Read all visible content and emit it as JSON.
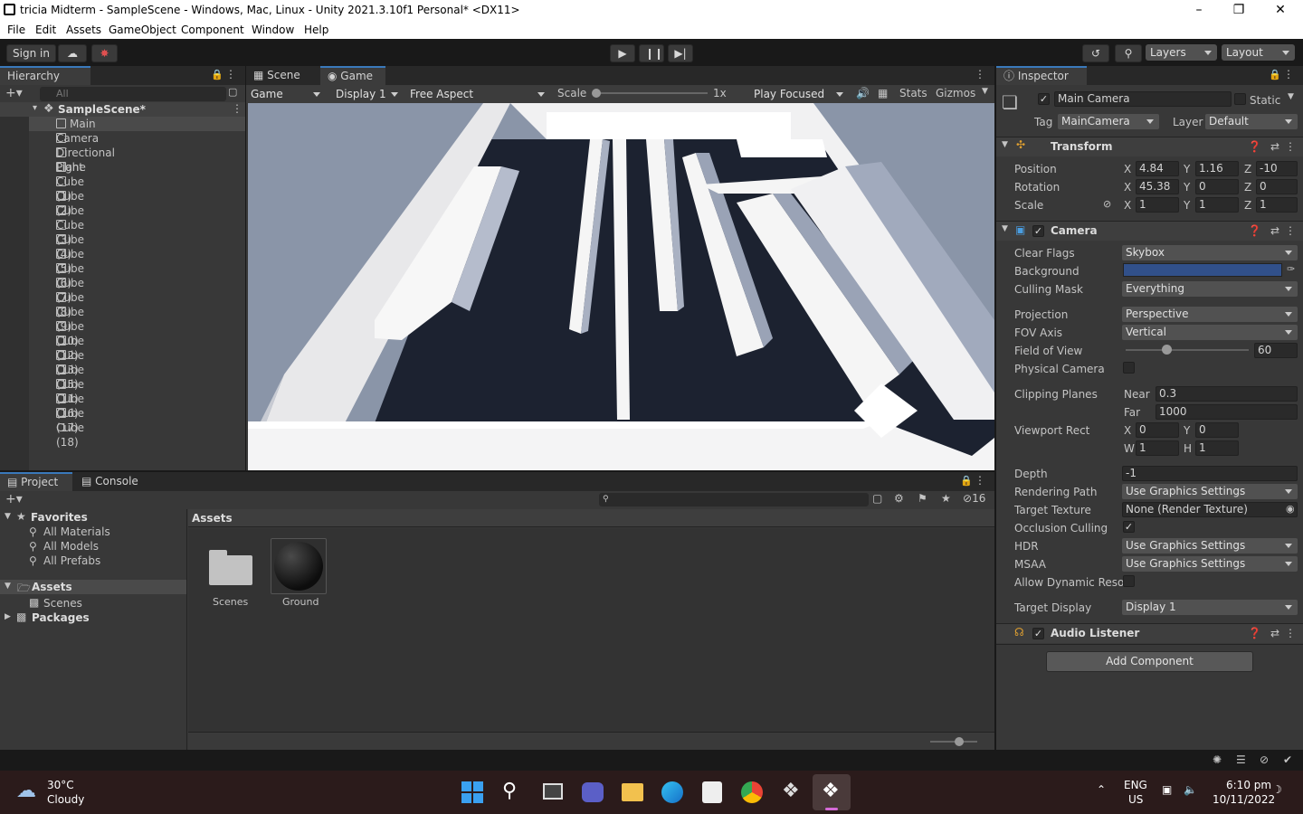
{
  "window": {
    "title": "tricia Midterm - SampleScene - Windows, Mac, Linux - Unity 2021.3.10f1 Personal* <DX11>"
  },
  "menu": [
    "File",
    "Edit",
    "Assets",
    "GameObject",
    "Component",
    "Window",
    "Help"
  ],
  "toolbar": {
    "sign_in": "Sign in",
    "layers": "Layers",
    "layout": "Layout"
  },
  "hierarchy": {
    "tab": "Hierarchy",
    "search_placeholder": "All",
    "scene": "SampleScene*",
    "items": [
      "Main Camera",
      "Directional Light",
      "Plane",
      "Cube (1)",
      "Cube (2)",
      "Cube",
      "Cube (3)",
      "Cube (4)",
      "Cube (5)",
      "Cube (6)",
      "Cube (7)",
      "Cube (8)",
      "Cube (9)",
      "Cube (10)",
      "Cube (12)",
      "Cube (13)",
      "Cube (15)",
      "Cube (11)",
      "Cube (16)",
      "Cube (17)",
      "Cube (18)"
    ]
  },
  "game": {
    "tabs": [
      "Scene",
      "Game"
    ],
    "mode": "Game",
    "display": "Display 1",
    "aspect": "Free Aspect",
    "scale_label": "Scale",
    "scale_value": "1x",
    "play_focused": "Play Focused",
    "stats": "Stats",
    "gizmos": "Gizmos"
  },
  "inspector": {
    "tab": "Inspector",
    "object_name": "Main Camera",
    "static": "Static",
    "tag_label": "Tag",
    "tag": "MainCamera",
    "layer_label": "Layer",
    "layer": "Default",
    "transform": {
      "title": "Transform",
      "position_label": "Position",
      "rotation_label": "Rotation",
      "scale_label": "Scale",
      "position": {
        "x": "4.84",
        "y": "1.16",
        "z": "-10"
      },
      "rotation": {
        "x": "45.38",
        "y": "0",
        "z": "0"
      },
      "scale": {
        "x": "1",
        "y": "1",
        "z": "1"
      }
    },
    "camera": {
      "title": "Camera",
      "clear_flags_label": "Clear Flags",
      "clear_flags": "Skybox",
      "background_label": "Background",
      "background_color": "#31508a",
      "culling_mask_label": "Culling Mask",
      "culling_mask": "Everything",
      "projection_label": "Projection",
      "projection": "Perspective",
      "fov_axis_label": "FOV Axis",
      "fov_axis": "Vertical",
      "fov_label": "Field of View",
      "fov": "60",
      "fov_fraction": 0.33,
      "physical_label": "Physical Camera",
      "clipping_label": "Clipping Planes",
      "near_label": "Near",
      "near": "0.3",
      "far_label": "Far",
      "far": "1000",
      "viewport_label": "Viewport Rect",
      "vx": "0",
      "vy": "0",
      "vw": "1",
      "vh": "1",
      "depth_label": "Depth",
      "depth": "-1",
      "rendering_path_label": "Rendering Path",
      "rendering_path": "Use Graphics Settings",
      "target_texture_label": "Target Texture",
      "target_texture": "None (Render Texture)",
      "occlusion_label": "Occlusion Culling",
      "hdr_label": "HDR",
      "hdr": "Use Graphics Settings",
      "msaa_label": "MSAA",
      "msaa": "Use Graphics Settings",
      "dynres_label": "Allow Dynamic Resol",
      "target_display_label": "Target Display",
      "target_display": "Display 1"
    },
    "audio_listener": "Audio Listener",
    "add_component": "Add Component"
  },
  "project": {
    "tabs": [
      "Project",
      "Console"
    ],
    "hidden_count": "16",
    "favorites": "Favorites",
    "fav_items": [
      "All Materials",
      "All Models",
      "All Prefabs"
    ],
    "assets": "Assets",
    "scenes": "Scenes",
    "packages": "Packages",
    "breadcrumb": "Assets",
    "files": [
      "Scenes",
      "Ground"
    ]
  },
  "taskbar": {
    "temp": "30°C",
    "weather": "Cloudy",
    "lang1": "ENG",
    "lang2": "US",
    "time": "6:10 pm",
    "date": "10/11/2022"
  }
}
